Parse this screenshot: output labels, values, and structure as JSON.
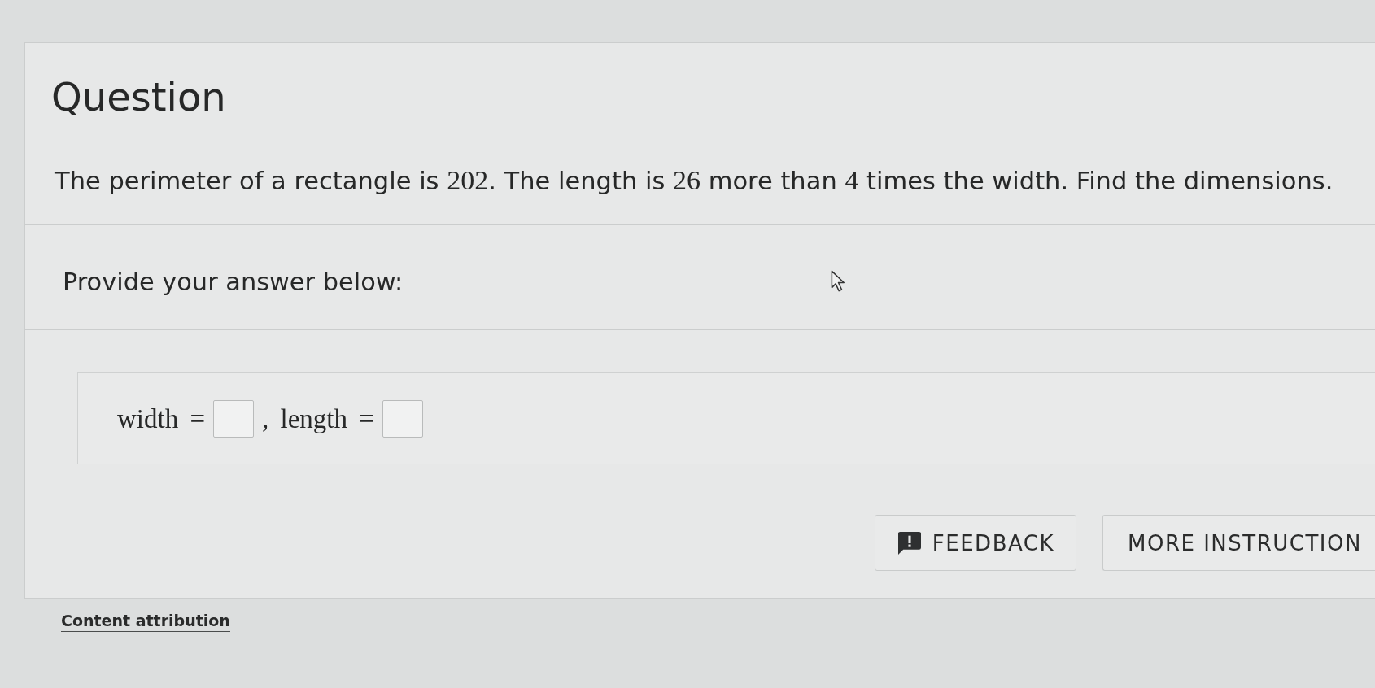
{
  "heading": "Question",
  "question": {
    "segments": [
      {
        "kind": "text",
        "text": "The perimeter of a rectangle is "
      },
      {
        "kind": "math",
        "text": "202"
      },
      {
        "kind": "text",
        "text": ". The length is "
      },
      {
        "kind": "math",
        "text": "26"
      },
      {
        "kind": "text",
        "text": " more than "
      },
      {
        "kind": "math",
        "text": "4"
      },
      {
        "kind": "text",
        "text": " times the width. Find the dimensions."
      }
    ]
  },
  "prompt": "Provide your answer below:",
  "answer": {
    "parts": [
      {
        "kind": "text",
        "text": "width ="
      },
      {
        "kind": "blank"
      },
      {
        "kind": "text",
        "text": ", length ="
      },
      {
        "kind": "blank"
      }
    ]
  },
  "buttons": [
    {
      "kind": "feedback",
      "label": "FEEDBACK"
    },
    {
      "kind": "plain",
      "label": "MORE INSTRUCTION"
    }
  ],
  "attribution_link": "Content attribution"
}
